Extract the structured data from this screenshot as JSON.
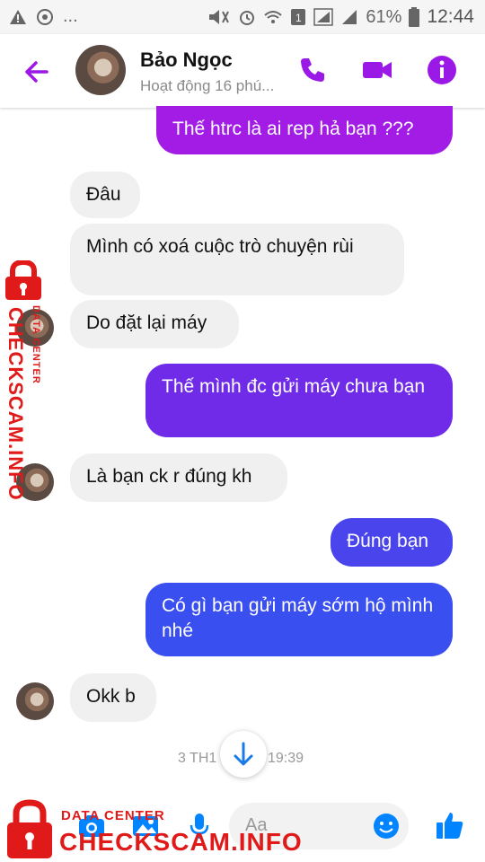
{
  "status_bar": {
    "left_icons": [
      "warning-icon",
      "sync-icon",
      "more-dots"
    ],
    "battery_percent": "61%",
    "time": "12:44",
    "dots": "..."
  },
  "header": {
    "contact_name": "Bảo Ngọc",
    "activity": "Hoạt động 16 phú...",
    "accent_color": "#9b19e6"
  },
  "messages": [
    {
      "side": "out",
      "text": "Thế htrc là ai rep hả bạn ???",
      "color": "#a21ce6"
    },
    {
      "side": "in",
      "text": "Đâu"
    },
    {
      "side": "in",
      "text": "Mình có xoá cuộc trò chuyện rùi"
    },
    {
      "side": "in",
      "text": "Do đặt lại máy"
    },
    {
      "side": "out",
      "text": "Thế mình đc gửi máy chưa bạn",
      "color": "#6f2be8"
    },
    {
      "side": "in",
      "text": "Là bạn ck r đúng kh"
    },
    {
      "side": "out",
      "text": "Đúng bạn",
      "color": "#4a44ec"
    },
    {
      "side": "out",
      "text": "Có gì bạn gửi máy sớm hộ mình nhé",
      "color": "#3a4ff0"
    },
    {
      "side": "in",
      "text": "Okk b"
    }
  ],
  "timestamp": {
    "left": "3 TH1",
    "right": "19:39"
  },
  "composer": {
    "placeholder": "Aa",
    "accent_color": "#0084ff"
  },
  "watermark": {
    "line1": "DATA CENTER",
    "line2": "CHECKSCAM.INFO",
    "color": "#e01919"
  }
}
